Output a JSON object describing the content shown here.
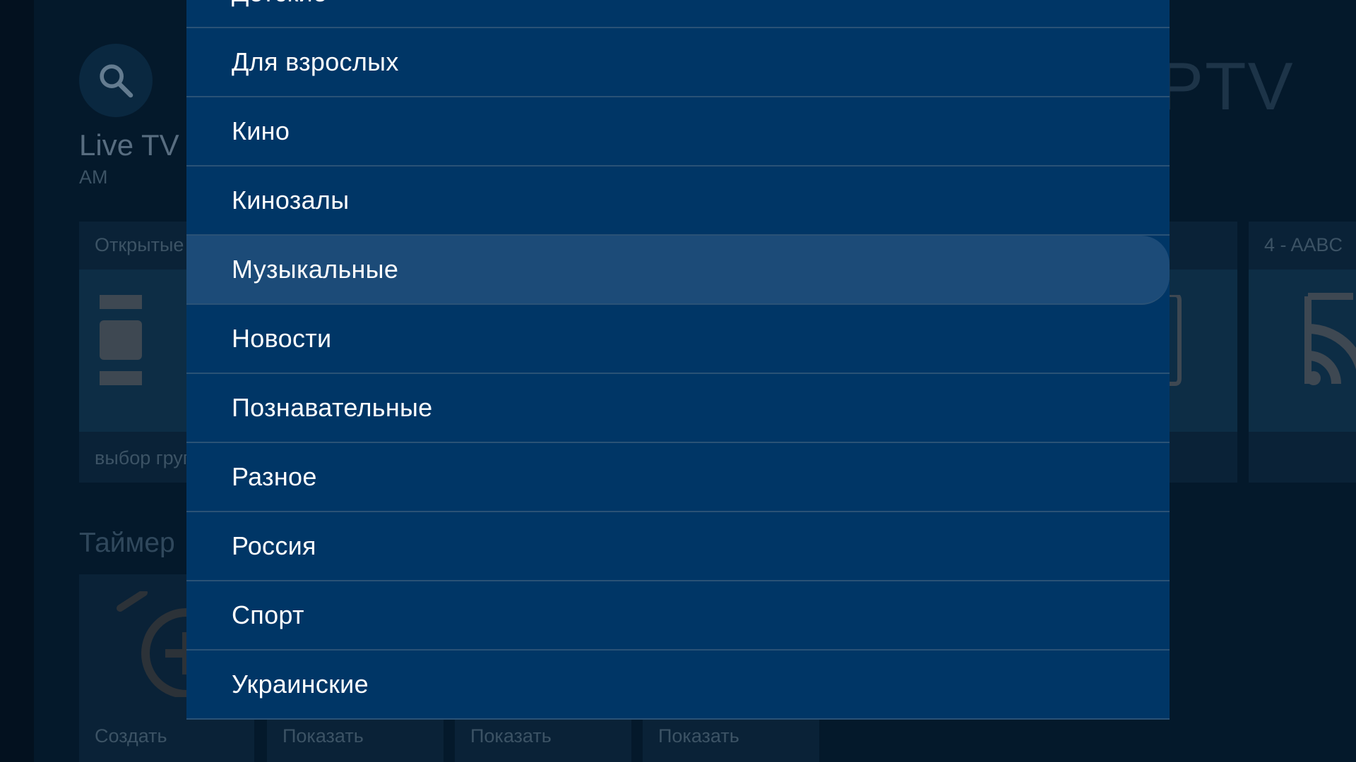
{
  "background": {
    "title": "Live TV",
    "subtitle": "AM",
    "brand": "PTV",
    "open_card": {
      "heading": "Открытые",
      "footer": "выбор груп"
    },
    "playlist_card": {
      "heading": "4 - AABC"
    },
    "timer": {
      "title": "Таймер",
      "buttons": [
        "Создать",
        "Показать",
        "Показать",
        "Показать"
      ]
    },
    "icons": [
      "search-icon",
      "list-icon",
      "tv-icon",
      "rss-icon",
      "alarm-add-icon"
    ]
  },
  "dropdown": {
    "items": [
      "Детские",
      "Для взрослых",
      "Кино",
      "Кинозалы",
      "Музыкальные",
      "Новости",
      "Познавательные",
      "Разное",
      "Россия",
      "Спорт",
      "Украинские"
    ],
    "selected": "Музыкальные"
  },
  "colors": {
    "dropdown_bg": "#003666",
    "selected_bg": "#1c4b78",
    "divider": "#2a5276",
    "text": "#ffffff"
  }
}
